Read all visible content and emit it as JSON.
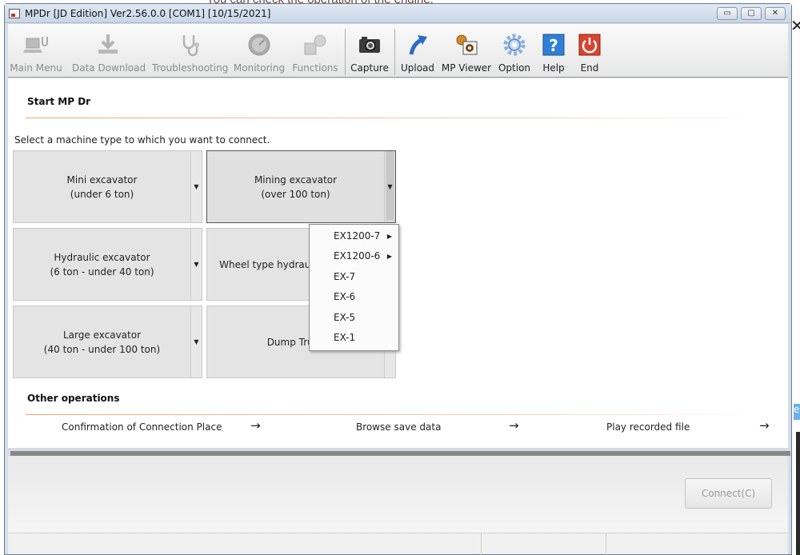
{
  "background": {
    "text": "You can check the operation of the engine.",
    "close_glyph": "✕",
    "edge_letter": "e"
  },
  "window": {
    "title": "MPDr [JD Edition] Ver2.56.0.0 [COM1] [10/15/2021]",
    "controls": {
      "minimize": "▭",
      "maximize": "▢",
      "close": "✕"
    }
  },
  "toolbar": {
    "items": [
      {
        "label": "Main Menu",
        "icon": "laptop-icon",
        "enabled": false
      },
      {
        "label": "Data Download",
        "icon": "download-icon",
        "enabled": false
      },
      {
        "label": "Troubleshooting",
        "icon": "stethoscope-icon",
        "enabled": false
      },
      {
        "label": "Monitoring",
        "icon": "gauge-icon",
        "enabled": false
      },
      {
        "label": "Functions",
        "icon": "functions-icon",
        "enabled": false
      },
      {
        "label": "Capture",
        "icon": "camera-icon",
        "enabled": true
      },
      {
        "label": "Upload",
        "icon": "upload-icon",
        "enabled": true
      },
      {
        "label": "MP Viewer",
        "icon": "mp-viewer-icon",
        "enabled": true
      },
      {
        "label": "Option",
        "icon": "gear-icon",
        "enabled": true
      },
      {
        "label": "Help",
        "icon": "help-icon",
        "enabled": true
      },
      {
        "label": "End",
        "icon": "power-icon",
        "enabled": true
      }
    ]
  },
  "main": {
    "start_title": "Start MP Dr",
    "prompt": "Select a machine type to which you want to connect.",
    "machines": [
      {
        "line1": "Mini excavator",
        "line2": "(under 6 ton)"
      },
      {
        "line1": "Mining excavator",
        "line2": "(over 100 ton)"
      },
      {
        "line1": "Hydraulic excavator",
        "line2": "(6 ton - under 40 ton)"
      },
      {
        "line1": "Wheel type hydraulic excavator",
        "line2": ""
      },
      {
        "line1": "Large excavator",
        "line2": "(40 ton - under 100 ton)"
      },
      {
        "line1": "Dump Truck",
        "line2": ""
      }
    ],
    "dropdown_glyph": "▼",
    "popup": {
      "items": [
        {
          "label": "EX1200-7",
          "submenu": "▶"
        },
        {
          "label": "EX1200-6",
          "submenu": "▶"
        },
        {
          "label": "EX-7",
          "submenu": ""
        },
        {
          "label": "EX-6",
          "submenu": ""
        },
        {
          "label": "EX-5",
          "submenu": ""
        },
        {
          "label": "EX-1",
          "submenu": ""
        }
      ]
    },
    "other_title": "Other operations",
    "operations": [
      {
        "label": "Confirmation of Connection Place",
        "arrow": "→"
      },
      {
        "label": "Browse save data",
        "arrow": "→"
      },
      {
        "label": "Play recorded file",
        "arrow": "→"
      }
    ]
  },
  "footer": {
    "connect_label": "Connect(C)"
  },
  "colors": {
    "accent_rule": "#e8a674",
    "help_blue": "#2f7fd6",
    "end_red": "#d9432f"
  }
}
